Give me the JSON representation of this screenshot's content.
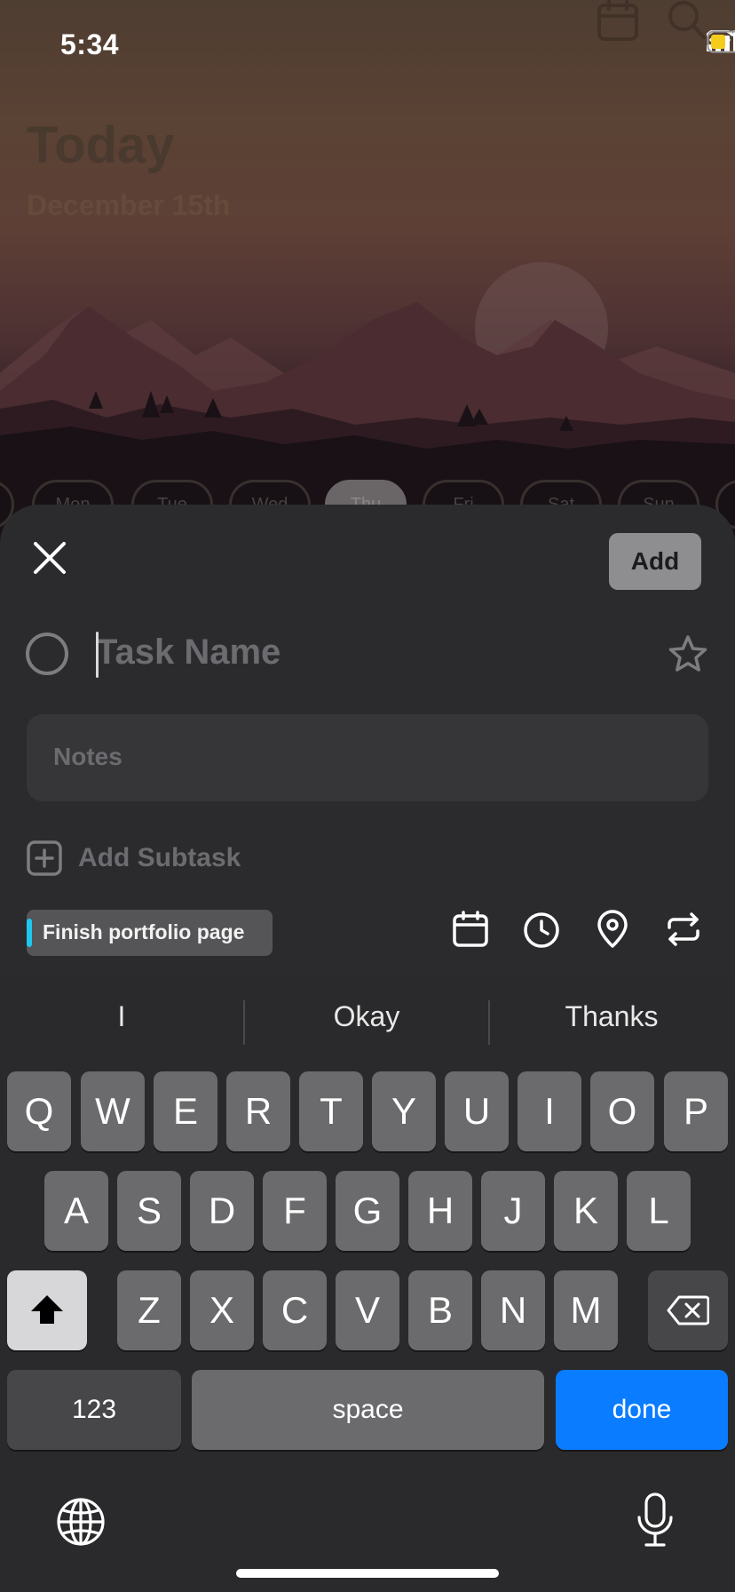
{
  "status_bar": {
    "time": "5:34"
  },
  "background": {
    "title": "Today",
    "date": "December 15th",
    "days": [
      "Mon",
      "Tue",
      "Wed",
      "Thu",
      "Fri",
      "Sat",
      "Sun"
    ],
    "active_day": "Thu"
  },
  "sheet": {
    "add_label": "Add",
    "task_placeholder": "Task Name",
    "notes_placeholder": "Notes",
    "add_subtask_label": "Add Subtask",
    "tag_label": "Finish portfolio page",
    "tag_color": "#1ec7ee",
    "tools": [
      "calendar-icon",
      "clock-icon",
      "location-pin-icon",
      "repeat-icon"
    ]
  },
  "keyboard": {
    "suggestions": [
      "I",
      "Okay",
      "Thanks"
    ],
    "row1": [
      "Q",
      "W",
      "E",
      "R",
      "T",
      "Y",
      "U",
      "I",
      "O",
      "P"
    ],
    "row2": [
      "A",
      "S",
      "D",
      "F",
      "G",
      "H",
      "J",
      "K",
      "L"
    ],
    "row3": [
      "Z",
      "X",
      "C",
      "V",
      "B",
      "N",
      "M"
    ],
    "numbers_label": "123",
    "space_label": "space",
    "done_label": "done",
    "done_color": "#0a7cff"
  }
}
